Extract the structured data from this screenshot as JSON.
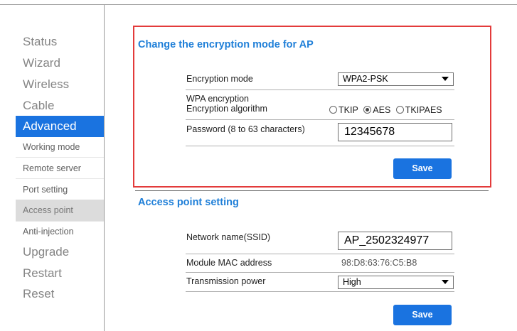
{
  "sidebar": {
    "items": [
      {
        "label": "Status"
      },
      {
        "label": "Wizard"
      },
      {
        "label": "Wireless"
      },
      {
        "label": "Cable"
      },
      {
        "label": "Advanced"
      },
      {
        "label": "Working mode"
      },
      {
        "label": "Remote server"
      },
      {
        "label": "Port setting"
      },
      {
        "label": "Access point"
      },
      {
        "label": "Anti-injection"
      },
      {
        "label": "Upgrade"
      },
      {
        "label": "Restart"
      },
      {
        "label": "Reset"
      }
    ]
  },
  "encryption": {
    "title": "Change the encryption mode for AP",
    "mode_label": "Encryption mode",
    "mode_value": "WPA2-PSK",
    "wpa_label_1": "WPA encryption",
    "wpa_label_2": "Encryption algorithm",
    "radio_tkip": "TKIP",
    "radio_aes": "AES",
    "radio_tkipaes": "TKIPAES",
    "selected_algorithm": "AES",
    "password_label": "Password (8 to 63 characters)",
    "password_value": "12345678",
    "save_label": "Save"
  },
  "access_point": {
    "title": "Access point setting",
    "ssid_label": "Network name(SSID)",
    "ssid_value": "AP_2502324977",
    "mac_label": "Module MAC address",
    "mac_value": "98:D8:63:76:C5:B8",
    "power_label": "Transmission power",
    "power_value": "High",
    "save_label": "Save"
  },
  "colors": {
    "accent": "#1a73e0",
    "highlight_border": "#e33b3b",
    "title": "#1f7fd8"
  }
}
